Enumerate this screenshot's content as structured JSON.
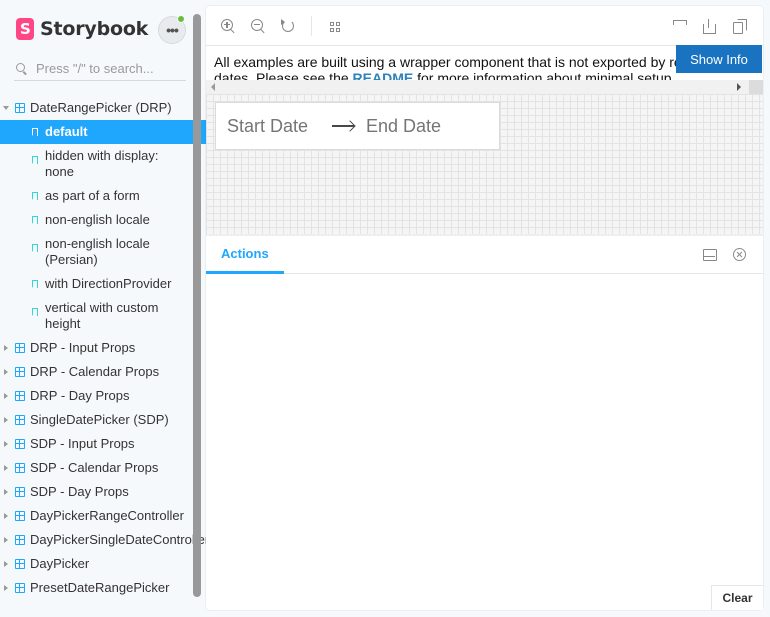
{
  "brand": {
    "name": "Storybook",
    "logo_letter": "S"
  },
  "menu": {
    "label": "•••"
  },
  "search": {
    "placeholder": "Press \"/\" to search..."
  },
  "tree": {
    "group_open": "DateRangePicker (DRP)",
    "stories": [
      "default",
      "hidden with display: none",
      "as part of a form",
      "non-english locale",
      "non-english locale (Persian)",
      "with DirectionProvider",
      "vertical with custom height"
    ],
    "groups": [
      "DRP - Input Props",
      "DRP - Calendar Props",
      "DRP - Day Props",
      "SingleDatePicker (SDP)",
      "SDP - Input Props",
      "SDP - Calendar Props",
      "SDP - Day Props",
      "DayPickerRangeController",
      "DayPickerSingleDateController",
      "DayPicker",
      "PresetDateRangePicker"
    ]
  },
  "preview": {
    "info_line1": "All examples are built using a wrapper component that is not exported by re",
    "info_line2_prefix": "dates. Please see the ",
    "info_link": "README",
    "info_line2_suffix": " for more information about minimal setup or",
    "show_info": "Show Info",
    "start_date": "Start Date",
    "end_date": "End Date"
  },
  "addons": {
    "tab": "Actions",
    "clear": "Clear"
  }
}
